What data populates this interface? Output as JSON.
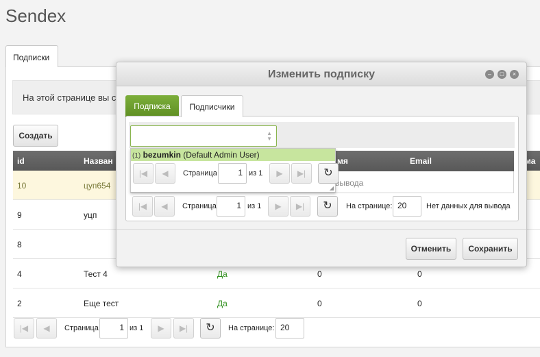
{
  "app": {
    "title": "Sendex"
  },
  "main_tabs": [
    {
      "label": "Подписки"
    }
  ],
  "info": {
    "text": "На этой странице вы с"
  },
  "toolbar": {
    "create_label": "Создать"
  },
  "table": {
    "columns": [
      "id",
      "Назван",
      "",
      "",
      "",
      "ма"
    ],
    "rows": [
      {
        "id": "10",
        "name": "цуп654",
        "active": "",
        "a": "",
        "b": ""
      },
      {
        "id": "9",
        "name": "уцп",
        "active": "",
        "a": "",
        "b": ""
      },
      {
        "id": "8",
        "name": "",
        "active": "",
        "a": "",
        "b": ""
      },
      {
        "id": "4",
        "name": "Тест 4",
        "active": "Да",
        "a": "0",
        "b": "0"
      },
      {
        "id": "2",
        "name": "Еще тест",
        "active": "Да",
        "a": "0",
        "b": "0"
      }
    ]
  },
  "pager": {
    "page_label": "Страница",
    "page_value": "1",
    "of_label": "из 1",
    "per_page_label": "На странице:",
    "per_page_value": "20"
  },
  "modal": {
    "title": "Изменить подписку",
    "tabs": [
      {
        "label": "Подписка"
      },
      {
        "label": "Подписчики"
      }
    ],
    "inner_table": {
      "columns": [
        "мя",
        "Email"
      ],
      "empty_text": "вывода"
    },
    "dropdown": {
      "count": "(1)",
      "username": "bezumkin",
      "fullname": "(Default Admin User)"
    },
    "dropdown_pager": {
      "page_label": "Страница",
      "page_value": "1",
      "of_label": "из 1"
    },
    "pager": {
      "page_label": "Страница",
      "page_value": "1",
      "of_label": "из 1",
      "per_page_label": "На странице:",
      "per_page_value": "20",
      "no_data": "Нет данных для вывода"
    },
    "cancel_label": "Отменить",
    "save_label": "Сохранить"
  }
}
